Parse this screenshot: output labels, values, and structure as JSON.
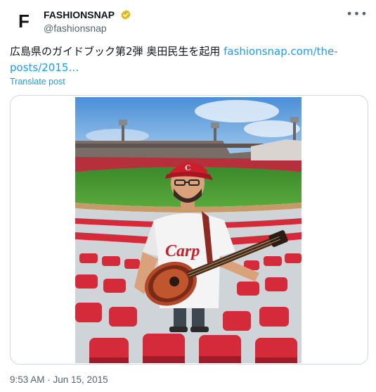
{
  "tweet": {
    "avatar_letter": "F",
    "display_name": "FASHIONSNAP",
    "handle": "@fashionsnap",
    "verified_color": "#e2b719",
    "text": "広島県のガイドブック第2弾 奥田民生を起用 ",
    "link_text": "fashionsnap.com/the-posts/2015…",
    "translate_label": "Translate post",
    "more_icon": "more-icon",
    "timestamp": "9:53 AM · Jun 15, 2015"
  },
  "photo": {
    "jersey_text": "Carp",
    "colors": {
      "sky": "#5b9bd8",
      "field": "#3d8f2e",
      "seats": "#d42a3a",
      "cap": "#cc1e2b"
    }
  },
  "colors": {
    "link": "#1d9bf0",
    "secondary": "#536471",
    "border": "#cfd9de"
  }
}
